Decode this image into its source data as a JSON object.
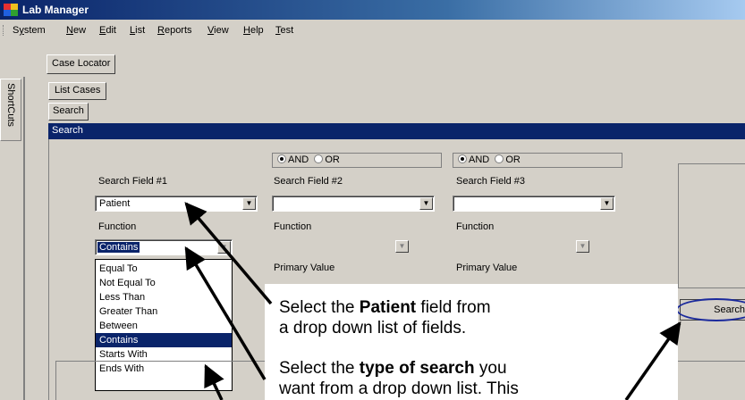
{
  "window": {
    "title": "Lab Manager"
  },
  "menu": {
    "items": [
      {
        "pre": "S",
        "ul": "y",
        "post": "stem"
      },
      {
        "pre": "",
        "ul": "N",
        "post": "ew"
      },
      {
        "pre": "",
        "ul": "E",
        "post": "dit"
      },
      {
        "pre": "",
        "ul": "L",
        "post": "ist"
      },
      {
        "pre": "",
        "ul": "R",
        "post": "eports"
      },
      {
        "pre": "",
        "ul": "V",
        "post": "iew"
      },
      {
        "pre": "",
        "ul": "H",
        "post": "elp"
      },
      {
        "pre": "",
        "ul": "T",
        "post": "est"
      }
    ]
  },
  "toolbar": {
    "case_locator": "Case Locator"
  },
  "shortcuts": {
    "label": "ShortCuts"
  },
  "tabs": {
    "list_cases": "List Cases",
    "search": "Search"
  },
  "panel": {
    "title": "Search"
  },
  "logic": {
    "and": "AND",
    "or": "OR",
    "selected": "AND"
  },
  "fields": {
    "field1": {
      "label": "Search Field #1",
      "value": "Patient",
      "function_label": "Function",
      "function_value": "Contains"
    },
    "field2": {
      "label": "Search Field #2",
      "value": "",
      "function_label": "Function",
      "primary_label": "Primary Value"
    },
    "field3": {
      "label": "Search Field #3",
      "value": "",
      "function_label": "Function",
      "primary_label": "Primary Value"
    }
  },
  "function_options": [
    "Equal To",
    "Not Equal To",
    "Less Than",
    "Greater Than",
    "Between",
    "Contains",
    "Starts With",
    "Ends With"
  ],
  "function_selected": "Contains",
  "search_button": "Search",
  "callouts": {
    "patient": {
      "pre": "Select the ",
      "bold": "Patient",
      "post": " field from",
      "line2": "a drop down list of fields."
    },
    "type": {
      "pre": "Select the ",
      "bold": "type of search",
      "post": " you",
      "line2": "want from a drop down list. This"
    }
  },
  "colors": {
    "header": "#0a246a",
    "face": "#d4d0c8",
    "ellipse": "#1b2a9c"
  }
}
